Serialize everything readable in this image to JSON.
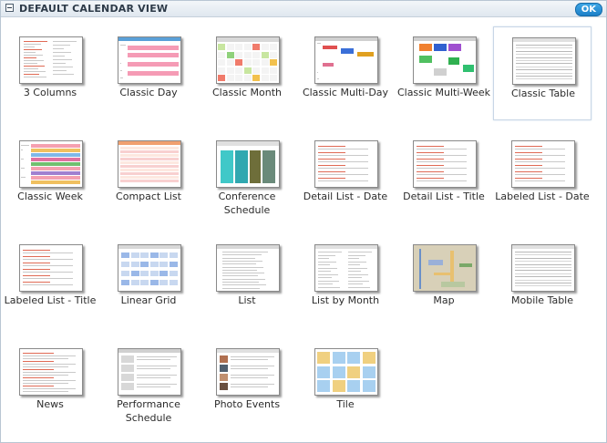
{
  "header": {
    "title": "DEFAULT CALENDAR VIEW",
    "ok_label": "OK"
  },
  "views": [
    {
      "label": "3 Columns",
      "style": "lines-red"
    },
    {
      "label": "Classic Day",
      "style": "pink-bands"
    },
    {
      "label": "Classic Month",
      "style": "month-grid"
    },
    {
      "label": "Classic Multi-Day",
      "style": "multiday"
    },
    {
      "label": "Classic Multi-Week",
      "style": "multiweek"
    },
    {
      "label": "Classic Table",
      "style": "table",
      "selected": true
    },
    {
      "label": "Classic Week",
      "style": "week"
    },
    {
      "label": "Compact List",
      "style": "compact"
    },
    {
      "label": "Conference Schedule",
      "style": "conference"
    },
    {
      "label": "Detail List - Date",
      "style": "detail"
    },
    {
      "label": "Detail List - Title",
      "style": "detail"
    },
    {
      "label": "Labeled List - Date",
      "style": "detail"
    },
    {
      "label": "Labeled List - Title",
      "style": "detail"
    },
    {
      "label": "Linear Grid",
      "style": "linear"
    },
    {
      "label": "List",
      "style": "list"
    },
    {
      "label": "List by Month",
      "style": "listmonth"
    },
    {
      "label": "Map",
      "style": "map"
    },
    {
      "label": "Mobile Table",
      "style": "table"
    },
    {
      "label": "News",
      "style": "news"
    },
    {
      "label": "Performance Schedule",
      "style": "performance"
    },
    {
      "label": "Photo Events",
      "style": "photo"
    },
    {
      "label": "Tile",
      "style": "tilegrid"
    }
  ],
  "colors": {
    "accent": "#1c7fc7",
    "header_bg": "#dfe7ef",
    "selected_border": "#c8d6e6"
  }
}
